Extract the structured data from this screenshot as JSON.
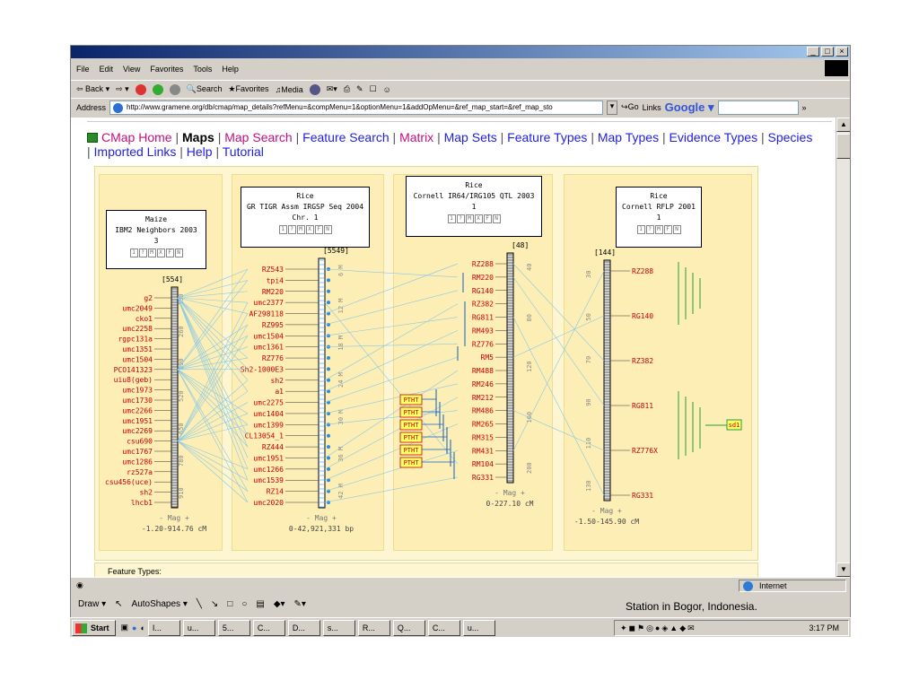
{
  "menu": [
    "File",
    "Edit",
    "View",
    "Favorites",
    "Tools",
    "Help"
  ],
  "toolbar": {
    "back": "Back",
    "search": "Search",
    "favorites": "Favorites",
    "media": "Media"
  },
  "address": {
    "label": "Address",
    "url": "http://www.gramene.org/db/cmap/map_details?refMenu=&compMenu=1&optionMenu=1&addOpMenu=&ref_map_start=&ref_map_sto",
    "go": "Go",
    "links": "Links",
    "google": "Google"
  },
  "nav": {
    "home": "CMap Home",
    "maps": "Maps",
    "map_search": "Map Search",
    "feature_search": "Feature Search",
    "matrix": "Matrix",
    "map_sets": "Map Sets",
    "feature_types": "Feature Types",
    "map_types": "Map Types",
    "evidence_types": "Evidence Types",
    "species": "Species",
    "imported_links": "Imported Links",
    "help": "Help",
    "tutorial": "Tutorial"
  },
  "maps": [
    {
      "species": "Maize",
      "set": "IBM2 Neighbors 2003",
      "chr": "3",
      "count": "[554]",
      "mag": "- Mag +",
      "range": "-1.20-914.76 cM",
      "features": [
        "g2",
        "umc2049",
        "cko1",
        "umc2258",
        "rgpc131a",
        "umc1351",
        "umc1504",
        "PCO141323",
        "uiu8(geb)",
        "umc1973",
        "umc1730",
        "umc2266",
        "umc1951",
        "umc2269",
        "csu690",
        "umc1767",
        "umc1286",
        "rz527a",
        "csu456(uce)",
        "sh2",
        "lhcb1"
      ],
      "ticks": [
        "130",
        "260",
        "390",
        "520",
        "650",
        "780",
        "910"
      ]
    },
    {
      "species": "Rice",
      "set": "GR TIGR Assm IRGSP Seq 2004",
      "chr": "Chr. 1",
      "count": "[5549]",
      "mag": "- Mag +",
      "range": "0-42,921,331 bp",
      "features": [
        "RZ543",
        "tpi4",
        "RM220",
        "umc2377",
        "AF298118",
        "RZ995",
        "umc1504",
        "umc1361",
        "RZ776",
        "Sh2-1000E3",
        "sh2",
        "a1",
        "umc2275",
        "umc1404",
        "umc1399",
        "CL13054_1",
        "RZ444",
        "umc1951",
        "umc1266",
        "umc1539",
        "RZ14",
        "umc2020"
      ],
      "ticks": [
        "6 M",
        "12 M",
        "18 M",
        "24 M",
        "30 M",
        "36 M",
        "42 M"
      ]
    },
    {
      "species": "Rice",
      "set": "Cornell IR64/IRG105 QTL 2003",
      "chr": "1",
      "count": "[48]",
      "mag": "- Mag +",
      "range": "0-227.10 cM",
      "features": [
        "RZ288",
        "RM220",
        "RG140",
        "RZ382",
        "RG811",
        "RM493",
        "RZ776",
        "RM5",
        "RM488",
        "RM246",
        "RM212",
        "RM486",
        "RM265",
        "RM315",
        "RM431",
        "RM104",
        "RG331"
      ],
      "ticks": [
        "40",
        "80",
        "120",
        "160",
        "200"
      ],
      "qtl": [
        "PTHT",
        "PTHT",
        "PTHT",
        "PTHT",
        "PTHT",
        "PTHT"
      ]
    },
    {
      "species": "Rice",
      "set": "Cornell RFLP 2001",
      "chr": "1",
      "count": "[144]",
      "mag": "- Mag +",
      "range": "-1.50-145.90 cM",
      "features": [
        "RZ288",
        "RG140",
        "RZ382",
        "RG811",
        "RZ776X",
        "RG331"
      ],
      "ticks": [
        "30",
        "50",
        "70",
        "90",
        "110",
        "130"
      ],
      "marker": "sd1"
    }
  ],
  "buttons": [
    "1",
    "?",
    "M",
    "X",
    "F",
    "N"
  ],
  "legend": "Feature Types:",
  "status": {
    "zone": "Internet"
  },
  "draw": {
    "draw": "Draw",
    "autoshapes": "AutoShapes"
  },
  "slide_text": "Station in Bogor, Indonesia.",
  "taskbar": {
    "start": "Start",
    "items": [
      "I...",
      "u...",
      "5...",
      "C...",
      "D...",
      "s...",
      "R...",
      "Q...",
      "C...",
      "u..."
    ],
    "clock": "3:17 PM"
  },
  "colors": {
    "feature": "#cc0000",
    "link": "#88c8e8",
    "qtl": "#1060c0",
    "green": "#22a040",
    "highlight": "#ffff66"
  }
}
